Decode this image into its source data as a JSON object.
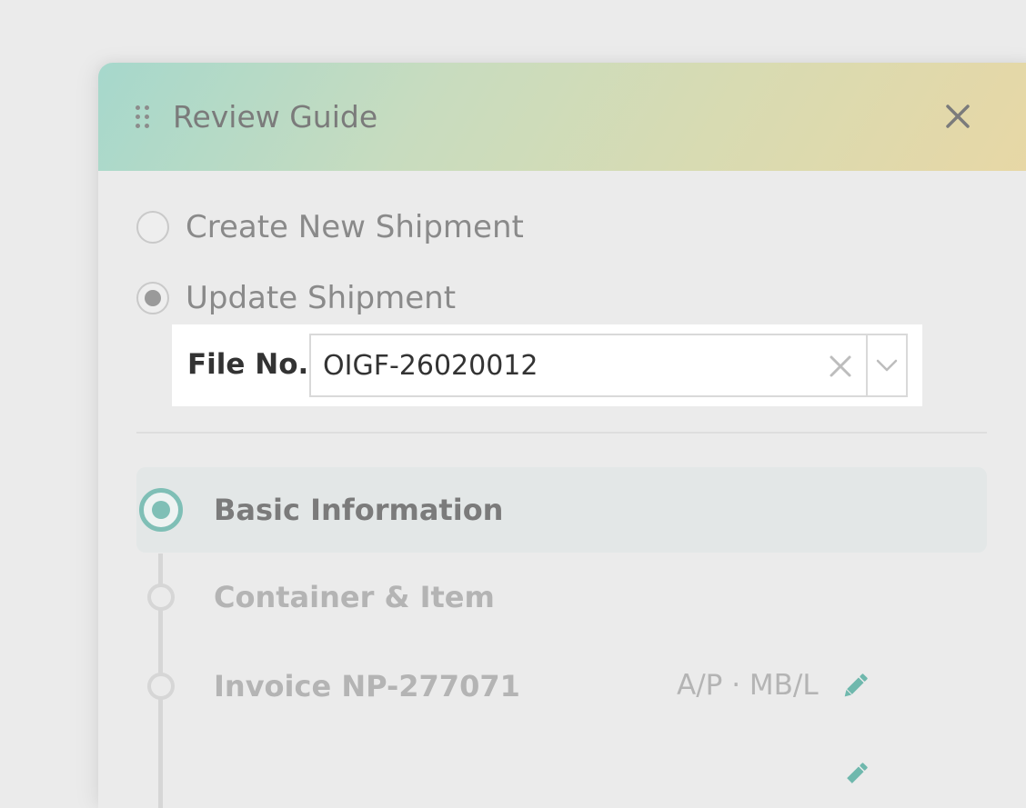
{
  "header": {
    "title": "Review Guide",
    "gradient": [
      "#a6d8cc",
      "#e8d7a5"
    ]
  },
  "mode": {
    "options": [
      {
        "label": "Create New Shipment",
        "selected": false
      },
      {
        "label": "Update Shipment",
        "selected": true
      }
    ]
  },
  "file": {
    "label": "File No.",
    "value": "OIGF-26020012"
  },
  "steps": [
    {
      "label": "Basic Information",
      "active": true
    },
    {
      "label": "Container & Item",
      "active": false
    },
    {
      "label": "Invoice NP-277071",
      "meta": "A/P · MB/L",
      "active": false
    }
  ],
  "colors": {
    "accent": "#7fbfb6",
    "edit_icon": "#6fb8ad"
  }
}
